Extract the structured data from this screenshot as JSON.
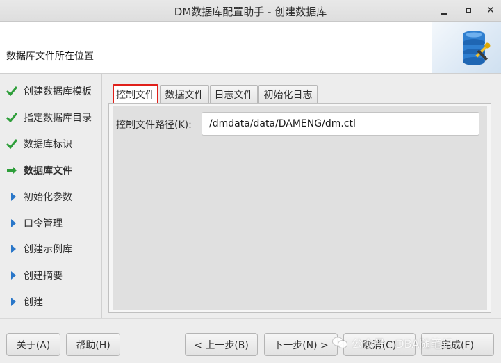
{
  "window": {
    "title": "DM数据库配置助手 - 创建数据库"
  },
  "header": {
    "heading": "数据库文件所在位置"
  },
  "nav": {
    "items": [
      {
        "label": "创建数据库模板",
        "state": "done"
      },
      {
        "label": "指定数据库目录",
        "state": "done"
      },
      {
        "label": "数据库标识",
        "state": "done"
      },
      {
        "label": "数据库文件",
        "state": "current"
      },
      {
        "label": "初始化参数",
        "state": "pending"
      },
      {
        "label": "口令管理",
        "state": "pending"
      },
      {
        "label": "创建示例库",
        "state": "pending"
      },
      {
        "label": "创建摘要",
        "state": "pending"
      },
      {
        "label": "创建",
        "state": "pending"
      }
    ]
  },
  "tabs": [
    {
      "label": "控制文件",
      "active": true
    },
    {
      "label": "数据文件",
      "active": false
    },
    {
      "label": "日志文件",
      "active": false
    },
    {
      "label": "初始化日志",
      "active": false
    }
  ],
  "control_file": {
    "label": "控制文件路径(K):",
    "value": "/dmdata/data/DAMENG/dm.ctl"
  },
  "footer": {
    "about": "关于(A)",
    "help": "帮助(H)",
    "prev": "< 上一步(B)",
    "next": "下一步(N) >",
    "cancel": "取消(C)",
    "finish": "完成(F)"
  },
  "watermark": "公众号 · DBA随笔记",
  "colors": {
    "check_green": "#2e9e3a",
    "arrow_green": "#2e9e3a",
    "pending_blue": "#2a77c9",
    "tab_highlight": "#e0201a"
  }
}
